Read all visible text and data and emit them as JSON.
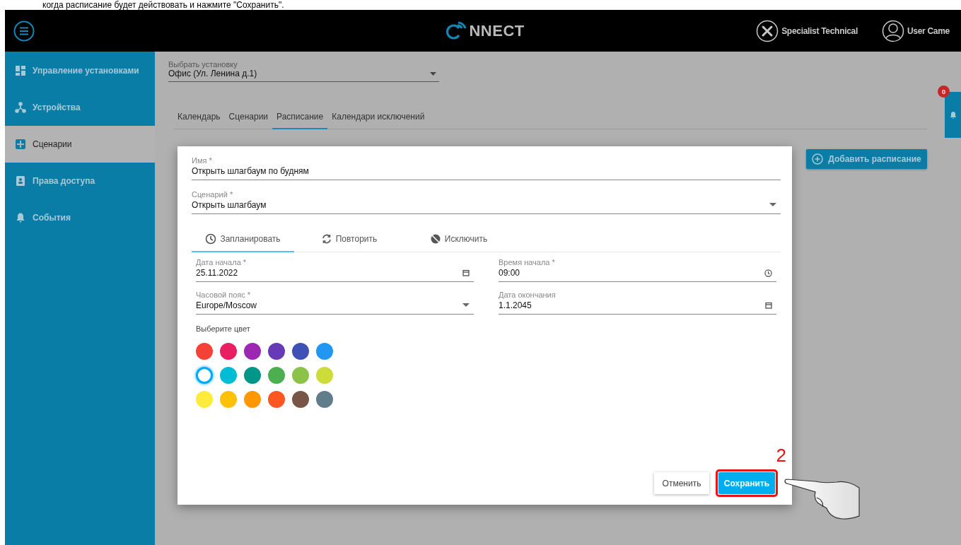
{
  "caption": "когда расписание будет действовать и нажмите \"Сохранить\".",
  "header": {
    "logo_text": "NNECT",
    "role": "Specialist Technical",
    "user": "User Came"
  },
  "sidebar": {
    "items": [
      {
        "label": "Управление установками",
        "kind": "installations",
        "selected": false
      },
      {
        "label": "Устройства",
        "kind": "devices",
        "selected": false
      },
      {
        "label": "Сценарии",
        "kind": "scenarios",
        "selected": true
      },
      {
        "label": "Права доступа",
        "kind": "access",
        "selected": false
      },
      {
        "label": "События",
        "kind": "events",
        "selected": false
      }
    ]
  },
  "installation_select": {
    "label": "Выбрать установку",
    "value": "Офис (Ул. Ленина д.1)"
  },
  "tabs": [
    {
      "label": "Календарь",
      "selected": false
    },
    {
      "label": "Сценарии",
      "selected": false
    },
    {
      "label": "Расписание",
      "selected": true
    },
    {
      "label": "Календари исключений",
      "selected": false
    }
  ],
  "add_button": "Добавить расписание",
  "notifications": {
    "count": "0"
  },
  "dialog": {
    "fields": [
      {
        "label": "Имя *",
        "value": "Открыть шлагбаум по будням",
        "kind": "text"
      },
      {
        "label": "Сценарий *",
        "value": "Открыть шлагбаум",
        "kind": "select"
      }
    ],
    "tabs": [
      {
        "label": "Запланировать",
        "kind": "clock",
        "selected": true
      },
      {
        "label": "Повторить",
        "kind": "repeat",
        "selected": false
      },
      {
        "label": "Исключить",
        "kind": "exclude",
        "selected": false
      }
    ],
    "schedule_fields": [
      {
        "label": "Дата начала *",
        "value": "25.11.2022",
        "kind": "date"
      },
      {
        "label": "Время начала *",
        "value": "09:00",
        "kind": "time"
      },
      {
        "label": "Часовой пояс *",
        "value": "Europe/Moscow",
        "kind": "select"
      },
      {
        "label": "Дата окончания",
        "value": "1.1.2045",
        "kind": "date"
      }
    ],
    "color_label": "Выберите цвет",
    "colors": [
      {
        "color": "#f44336",
        "selected": false
      },
      {
        "color": "#e91e63",
        "selected": false
      },
      {
        "color": "#9c27b0",
        "selected": false
      },
      {
        "color": "#673ab7",
        "selected": false
      },
      {
        "color": "#3f51b5",
        "selected": false
      },
      {
        "color": "#2196f3",
        "selected": false
      },
      {
        "color": "#ffffff",
        "selected": true
      },
      {
        "color": "#00bcd4",
        "selected": false
      },
      {
        "color": "#009688",
        "selected": false
      },
      {
        "color": "#4caf50",
        "selected": false
      },
      {
        "color": "#8bc34a",
        "selected": false
      },
      {
        "color": "#cddc39",
        "selected": false
      },
      {
        "color": "#ffeb3b",
        "selected": false
      },
      {
        "color": "#ffc107",
        "selected": false
      },
      {
        "color": "#ff9800",
        "selected": false
      },
      {
        "color": "#ff5722",
        "selected": false
      },
      {
        "color": "#795548",
        "selected": false
      },
      {
        "color": "#607d8b",
        "selected": false
      }
    ],
    "cancel": "Отменить",
    "save": "Сохранить"
  },
  "annotation": {
    "step": "2"
  }
}
